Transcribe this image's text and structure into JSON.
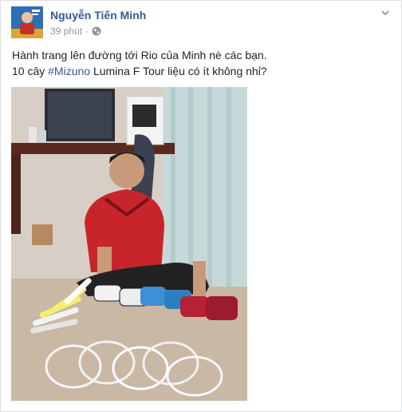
{
  "post": {
    "author": "Nguyễn Tiến Minh",
    "time": "39 phút",
    "separator": "·",
    "privacy_icon": "globe-icon",
    "menu_icon": "chevron-down-icon",
    "text_line1": "Hành trang lên đường tới Rio của Minh nè các bạn.",
    "text_line2_prefix": "10 cây ",
    "hashtag": "#Mizuno",
    "text_line2_suffix": " Lumina F Tour liệu có ít không nhỉ?"
  },
  "colors": {
    "name_link": "#365899",
    "meta_text": "#90949c",
    "body_text": "#1d2129",
    "card_border": "#dddfe2",
    "page_bg": "#e9ebee"
  }
}
